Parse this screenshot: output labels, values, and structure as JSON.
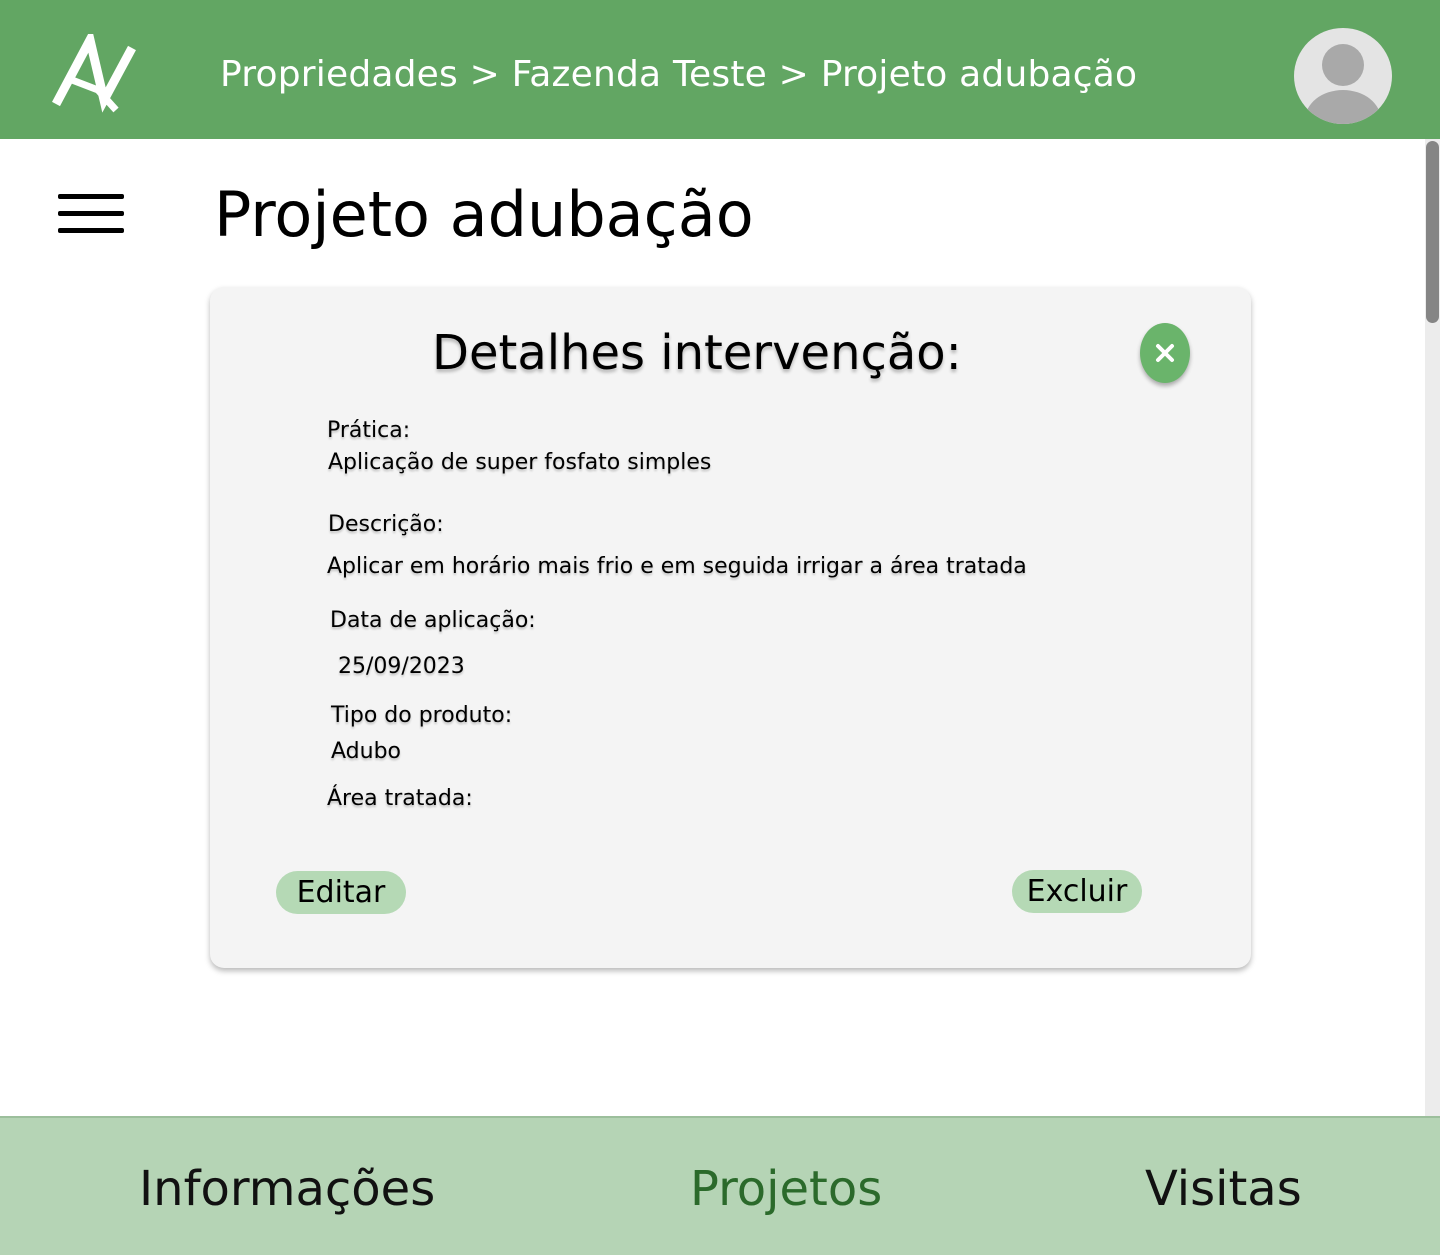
{
  "header": {
    "breadcrumb": [
      "Propriedades",
      "Fazenda Teste",
      "Projeto adubação"
    ],
    "separator": ">",
    "bg_color": "#62a663",
    "logo_icon": "logo-icon",
    "avatar_icon": "user-avatar-icon"
  },
  "page": {
    "title": "Projeto adubação",
    "menu_icon": "hamburger-menu-icon"
  },
  "card": {
    "title": "Detalhes intervenção:",
    "close_icon": "close-icon",
    "fields": {
      "pratica_label": "Prática:",
      "pratica_value": "Aplicação de super fosfato simples",
      "descricao_label": "Descrição:",
      "descricao_value": "Aplicar em horário mais frio e em seguida irrigar a área tratada",
      "data_label": "Data de aplicação:",
      "data_value": "25/09/2023",
      "tipo_label": "Tipo do produto:",
      "tipo_value": "Adubo",
      "area_label": "Área tratada:"
    },
    "edit_label": "Editar",
    "delete_label": "Excluir",
    "button_color": "#b5d9b5"
  },
  "bottom_nav": {
    "tabs": [
      {
        "label": "Informações",
        "active": false
      },
      {
        "label": "Projetos",
        "active": true
      },
      {
        "label": "Visitas",
        "active": false
      }
    ],
    "active_color": "#2b6a2b",
    "bg_color": "#b5d4b5"
  }
}
